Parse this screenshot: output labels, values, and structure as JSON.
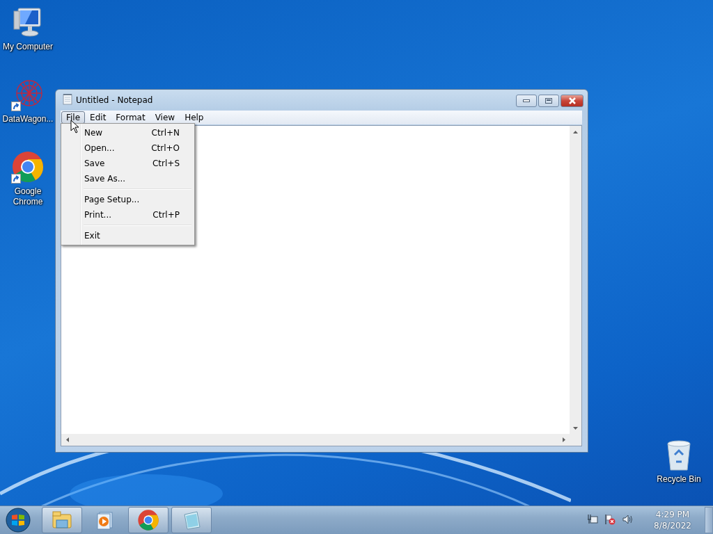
{
  "desktop_icons": [
    {
      "kind": "computer",
      "label": "My Computer",
      "shortcut": false
    },
    {
      "kind": "network",
      "label": "DataWagon...",
      "shortcut": true
    },
    {
      "kind": "chrome",
      "label": "Google Chrome",
      "shortcut": true
    },
    {
      "kind": "recycle",
      "label": "Recycle Bin",
      "shortcut": false
    }
  ],
  "window": {
    "title": "Untitled - Notepad",
    "menu": [
      {
        "label": "File",
        "selected": true
      },
      {
        "label": "Edit",
        "selected": false
      },
      {
        "label": "Format",
        "selected": false
      },
      {
        "label": "View",
        "selected": false
      },
      {
        "label": "Help",
        "selected": false
      }
    ],
    "file_menu": [
      [
        {
          "label": "New",
          "shortcut": "Ctrl+N"
        },
        {
          "label": "Open...",
          "shortcut": "Ctrl+O"
        },
        {
          "label": "Save",
          "shortcut": "Ctrl+S"
        },
        {
          "label": "Save As..."
        }
      ],
      [
        {
          "label": "Page Setup..."
        },
        {
          "label": "Print...",
          "shortcut": "Ctrl+P"
        }
      ],
      [
        {
          "label": "Exit"
        }
      ]
    ]
  },
  "taskbar": {
    "apps": [
      {
        "kind": "explorer",
        "running": true
      },
      {
        "kind": "media",
        "running": false
      },
      {
        "kind": "chrome",
        "running": true
      },
      {
        "kind": "notepad",
        "running": true
      }
    ],
    "clock": {
      "time": "4:29 PM",
      "date": "8/8/2022"
    }
  }
}
